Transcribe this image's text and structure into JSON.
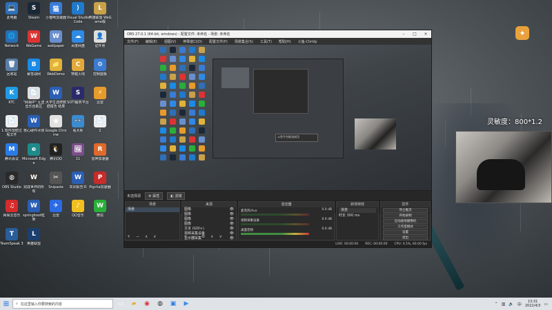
{
  "desktop": {
    "icons": [
      {
        "label": "此电脑",
        "glyph": "💻",
        "color": "#2f6fb8"
      },
      {
        "label": "Steam",
        "glyph": "S",
        "color": "#1b2838"
      },
      {
        "label": "小猫咪加速器",
        "glyph": "猫",
        "color": "#3a7bd5"
      },
      {
        "label": "Visual Studio Code",
        "glyph": "⟩",
        "color": "#1f7acb"
      },
      {
        "label": "英雄联盟 WeGame版",
        "glyph": "L",
        "color": "#c8a14a"
      },
      {
        "label": "Network",
        "glyph": "🌐",
        "color": "#2a6db0"
      },
      {
        "label": "WeGame",
        "glyph": "W",
        "color": "#d33"
      },
      {
        "label": "wallpaper",
        "glyph": "W",
        "color": "#6a8fcf"
      },
      {
        "label": "百度网盘",
        "glyph": "☁",
        "color": "#2e8ae6"
      },
      {
        "label": "证件照",
        "glyph": "👤",
        "color": "#ddd"
      },
      {
        "label": "回收站",
        "glyph": "🗑",
        "color": "#5a7ea8"
      },
      {
        "label": "暴雪战网",
        "glyph": "B",
        "color": "#1a8be6"
      },
      {
        "label": "WebDemo",
        "glyph": "📁",
        "color": "#e0b23a"
      },
      {
        "label": "穿越火线",
        "glyph": "C",
        "color": "#e2a93b"
      },
      {
        "label": "控制面板",
        "glyph": "⚙",
        "color": "#3b7bd0"
      },
      {
        "label": "KTC",
        "glyph": "K",
        "color": "#1f9be6"
      },
      {
        "label": "\"网易IP\" 互送音乐自助区",
        "glyph": "📄",
        "color": "#e0e0e0"
      },
      {
        "label": "大学生选修数据报告 结果",
        "glyph": "W",
        "color": "#2b5fb5"
      },
      {
        "label": "SOTI服务平台",
        "glyph": "S",
        "color": "#2a2a6a"
      },
      {
        "label": "迅雷",
        "glyph": "⚡",
        "color": "#e79b2b"
      },
      {
        "label": "1.软件加密过程文件",
        "glyph": "📄",
        "color": "#eee"
      },
      {
        "label": "核心硬件评测",
        "glyph": "W",
        "color": "#2b5fb5"
      },
      {
        "label": "Google Chrome",
        "glyph": "◉",
        "color": "#e1e1e1"
      },
      {
        "label": "看大师",
        "glyph": "👓",
        "color": "#3b8bd0"
      },
      {
        "label": "2",
        "glyph": "📄",
        "color": "#eee"
      },
      {
        "label": "腾讯会议",
        "glyph": "M",
        "color": "#2b7be6"
      },
      {
        "label": "Microsoft Edge",
        "glyph": "e",
        "color": "#1f8a8a"
      },
      {
        "label": "腾讯QQ",
        "glyph": "🐧",
        "color": "#222"
      },
      {
        "label": "11",
        "glyph": "🖼",
        "color": "#7a4f8a"
      },
      {
        "label": "雷神加速器",
        "glyph": "R",
        "color": "#e06a2b"
      },
      {
        "label": "OBS Studio",
        "glyph": "◍",
        "color": "#2a2a2a"
      },
      {
        "label": "完成世界的所有",
        "glyph": "W",
        "color": "#3a3a3a"
      },
      {
        "label": "Snipaste",
        "glyph": "✂",
        "color": "#555"
      },
      {
        "label": "实训报告书",
        "glyph": "W",
        "color": "#2b5fb5"
      },
      {
        "label": "Pigcha加速器",
        "glyph": "P",
        "color": "#c82b2b"
      },
      {
        "label": "网易云音乐",
        "glyph": "♫",
        "color": "#d62b2b"
      },
      {
        "label": "springboot框架",
        "glyph": "W",
        "color": "#2b5fb5"
      },
      {
        "label": "迅雷",
        "glyph": "✈",
        "color": "#2b6be6"
      },
      {
        "label": "QQ音乐",
        "glyph": "♪",
        "color": "#f2c01e"
      },
      {
        "label": "微信",
        "glyph": "W",
        "color": "#2aae3a"
      },
      {
        "label": "TeamSpeak 3",
        "glyph": "T",
        "color": "#2a5e9a"
      },
      {
        "label": "英雄联盟",
        "glyph": "L",
        "color": "#1c3f6e"
      }
    ],
    "sensitivity_label": "灵敏度：800*1.2"
  },
  "obs": {
    "title": "OBS 27.0.1 (64-bit, windows) - 配置文件: 未命名 - 场景: 未命名",
    "menu": [
      "文件(F)",
      "编辑(E)",
      "视图(V)",
      "停靠窗口(D)",
      "配置文件(P)",
      "场景集合(S)",
      "工具(T)",
      "帮助(H)",
      "斗鱼-Chrldy"
    ],
    "no_source": "未选择源",
    "properties_btn": "属性",
    "filters_btn": "滤镜",
    "panels": {
      "scenes_title": "场景",
      "scene_item": "场景",
      "sources_title": "来源",
      "sources": [
        "图像",
        "图像",
        "图像",
        "图像",
        "文本 (GDI+)",
        "视频采集设备",
        "显示器采集"
      ],
      "mixer_title": "混音器",
      "mixer": [
        {
          "name": "麦克风/Aux",
          "value": "0.0 dB"
        },
        {
          "name": "视频采集设备",
          "value": "0.0 dB"
        },
        {
          "name": "桌面音频",
          "value": "0.0 dB"
        }
      ],
      "transitions_title": "转场特效",
      "transition_type": "渐变",
      "duration_label": "时长",
      "duration_value": "300 ms",
      "controls_title": "控件",
      "controls": [
        "停止推流",
        "开始录制",
        "启动虚拟摄像机",
        "工作室模式",
        "设置",
        "退出"
      ]
    },
    "status": {
      "live": "LIVE: 00:00:00",
      "rec": "REC: 00:00:00",
      "cpu": "CPU: 4.5%, 60.00 fps"
    },
    "nested_dialog": "斗鱼平台推流成功"
  },
  "taskbar": {
    "search_placeholder": "在这里输入你要搜索的内容",
    "time": "13:31",
    "date": "2022/4/3",
    "apps": [
      "task-view",
      "explorer",
      "chrome",
      "obs",
      "meeting",
      "bilibili"
    ]
  }
}
